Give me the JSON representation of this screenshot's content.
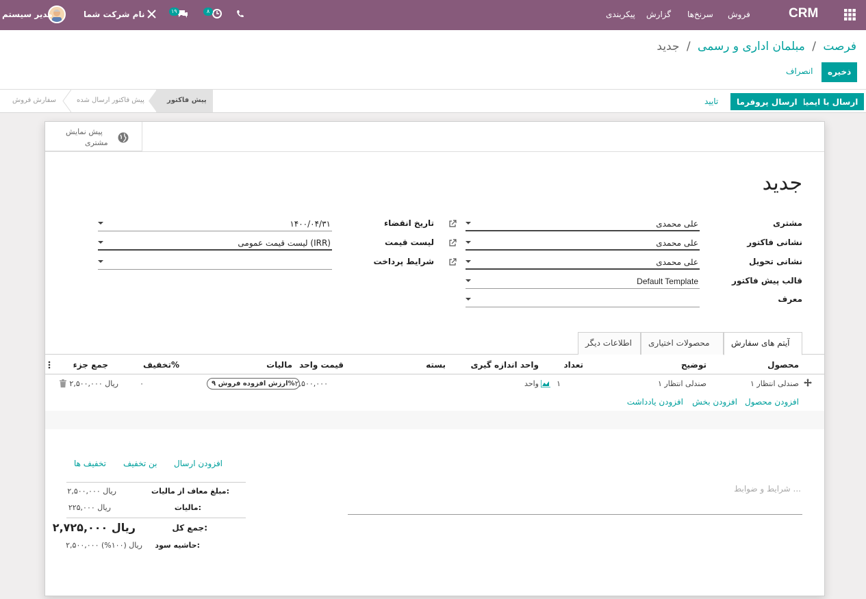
{
  "nav": {
    "app_name": "CRM",
    "menu": [
      "فروش",
      "سرنخ‌ها",
      "گزارش",
      "پیکربندی"
    ],
    "user_name": "مدیر سیستم",
    "company_name": "نام شرکت شما",
    "messages_count": "۱۹",
    "activities_count": "۸"
  },
  "breadcrumb": {
    "root": "فرصت",
    "parent": "مبلمان اداری و رسمی",
    "current": "جدید",
    "sep": "/"
  },
  "actions": {
    "save": "ذخیره",
    "discard": "انصراف"
  },
  "statusbar": {
    "send_email": "ارسال با ایمیل",
    "send_proforma": "ارسال پروفرما",
    "confirm": "تایید",
    "stages": [
      "پیش فاکتور",
      "پیش فاکتور ارسال شده",
      "سفارش فروش"
    ],
    "active_stage": "پیش فاکتور"
  },
  "smart_button": {
    "line1": "پیش نمایش",
    "line2": "مشتری"
  },
  "form": {
    "title": "جدید",
    "fields_right": [
      {
        "label": "مشتری",
        "value": "علی محمدی"
      },
      {
        "label": "نشانی فاکتور",
        "value": "علی محمدی"
      },
      {
        "label": "نشانی تحویل",
        "value": "علی محمدی"
      },
      {
        "label": "قالب پیش فاکتور",
        "value": "Default Template"
      },
      {
        "label": "معرف",
        "value": ""
      }
    ],
    "fields_left": [
      {
        "label": "تاریخ انقضاء",
        "value": "۱۴۰۰/۰۴/۳۱"
      },
      {
        "label": "لیست قیمت",
        "value": "لیست قیمت عمومی (IRR)"
      },
      {
        "label": "شرایط پرداخت",
        "value": ""
      }
    ]
  },
  "tabs": [
    "آیتم های سفارش",
    "محصولات اختیاری",
    "اطلاعات دیگر"
  ],
  "table": {
    "headers": {
      "product": "محصول",
      "description": "توضیح",
      "qty": "تعداد",
      "uom": "واحد اندازه گیری",
      "package": "بسته",
      "price": "قیمت واحد",
      "taxes": "مالیات",
      "discount": "تخفیف%",
      "subtotal": "جمع جزء"
    },
    "rows": [
      {
        "product": "صندلی انتظار ۱",
        "description": "صندلی انتظار ۱",
        "qty": "۱",
        "uom": "واحد",
        "price": "۲,۵۰۰,۰۰۰",
        "tax": "ارزش افزوده فروش ۹%",
        "discount": "۰",
        "subtotal": "۲,۵۰۰,۰۰۰ ریال"
      }
    ],
    "add_product": "افزودن محصول",
    "add_section": "افزودن بخش",
    "add_note": "افزودن یادداشت"
  },
  "extras": {
    "add_shipping": "افزودن ارسال",
    "coupon": "بن تخفیف",
    "discounts": "تخفیف ها"
  },
  "terms_placeholder": "شرایط و ضوابط ...",
  "totals": {
    "untaxed_label": "مبلغ معاف از مالیات:",
    "untaxed_value": "۲,۵۰۰,۰۰۰ ریال",
    "tax_label": "مالیات:",
    "tax_value": "۲۲۵,۰۰۰ ریال",
    "total_label": "جمع کل:",
    "total_value": "۲,۷۲۵,۰۰۰ ریال",
    "margin_label": "حاشیه سود:",
    "margin_value": "۲,۵۰۰,۰۰۰ ریال (۱۰۰%)"
  },
  "colors": {
    "navbar": "#875a7b",
    "accent": "#00a09d",
    "stage_active_bg": "#e2e2e2"
  }
}
